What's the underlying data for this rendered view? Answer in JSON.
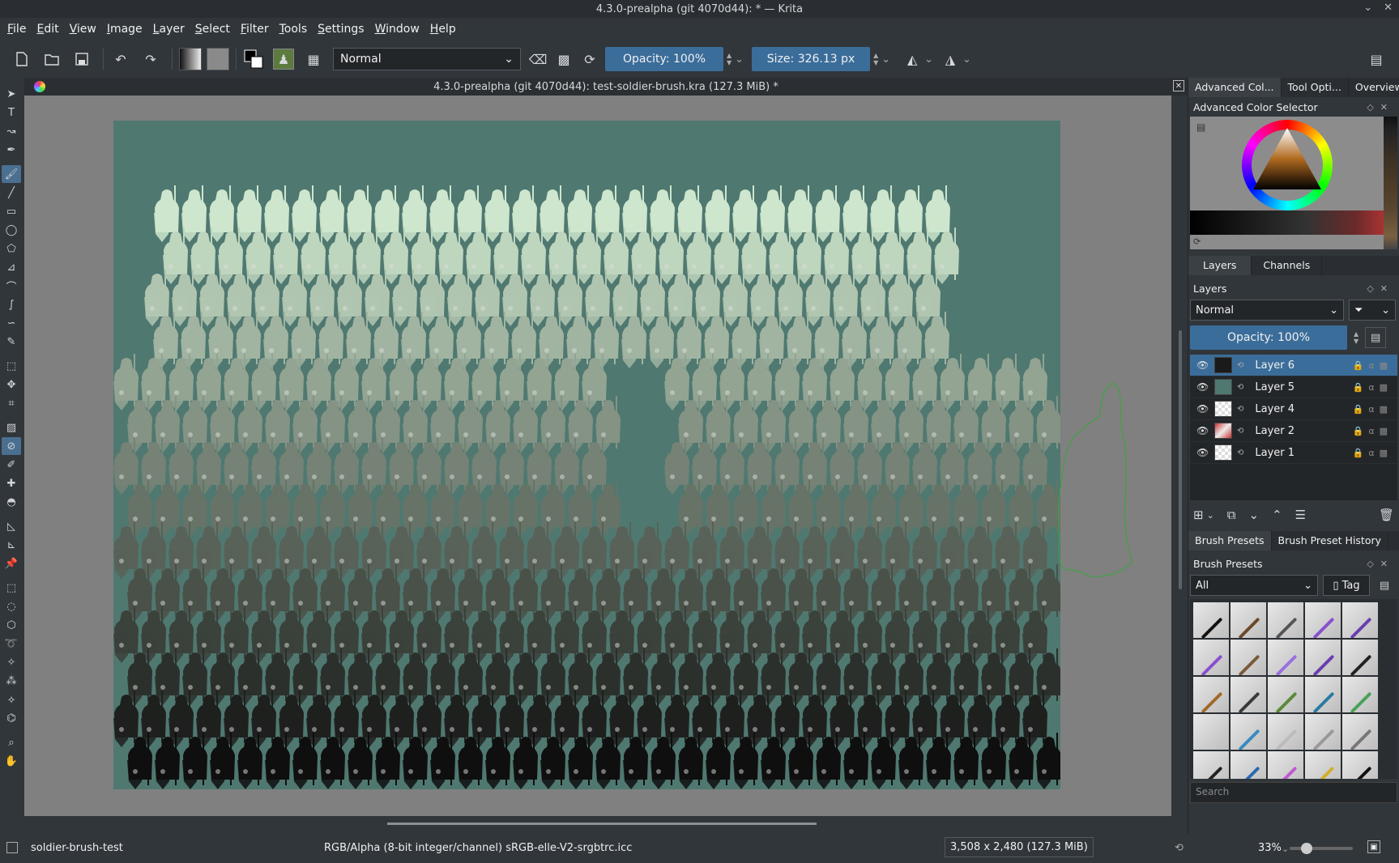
{
  "window": {
    "title": "4.3.0-prealpha (git 4070d44): * — Krita"
  },
  "menubar": {
    "items": [
      "File",
      "Edit",
      "View",
      "Image",
      "Layer",
      "Select",
      "Filter",
      "Tools",
      "Settings",
      "Window",
      "Help"
    ]
  },
  "toolbar": {
    "blend_mode": "Normal",
    "opacity": "Opacity: 100%",
    "size": "Size: 326.13 px",
    "icons": [
      "new-document-icon",
      "open-icon",
      "save-icon",
      "undo-icon",
      "redo-icon",
      "gradient-icon",
      "pattern-icon",
      "color-swap-icon",
      "brush-preset-icon",
      "brush-editor-icon",
      "eraser-icon",
      "alpha-lock-icon",
      "reload-icon",
      "mirror-horizontal-icon",
      "mirror-vertical-icon",
      "workspace-icon"
    ]
  },
  "document": {
    "tab_title": "4.3.0-prealpha (git 4070d44): test-soldier-brush.kra (127.3 MiB) *",
    "canvas_background": "#4f7870"
  },
  "docker": {
    "top_tabs": [
      "Advanced Col...",
      "Tool Opti...",
      "Overview"
    ],
    "color_selector_title": "Advanced Color Selector",
    "layers_tabs": [
      "Layers",
      "Channels"
    ],
    "layers_title": "Layers",
    "layers_blend": "Normal",
    "layers_opacity": "Opacity:  100%",
    "layers": [
      {
        "name": "Layer 6",
        "selected": true
      },
      {
        "name": "Layer 5",
        "selected": false
      },
      {
        "name": "Layer 4",
        "selected": false
      },
      {
        "name": "Layer 2",
        "selected": false
      },
      {
        "name": "Layer 1",
        "selected": false
      }
    ],
    "brush_tabs": [
      "Brush Presets",
      "Brush Preset History"
    ],
    "brush_title": "Brush Presets",
    "brush_filter": "All",
    "brush_tag": "Tag",
    "brush_search_placeholder": "Search"
  },
  "statusbar": {
    "brush_name": "soldier-brush-test",
    "color_model": "RGB/Alpha (8-bit integer/channel)  sRGB-elle-V2-srgbtrc.icc",
    "dimensions": "3,508 x 2,480 (127.3 MiB)",
    "zoom": "33%"
  },
  "colors": {
    "accent": "#3b6d9a",
    "panel": "#31363b",
    "canvas_surround": "#808080"
  }
}
